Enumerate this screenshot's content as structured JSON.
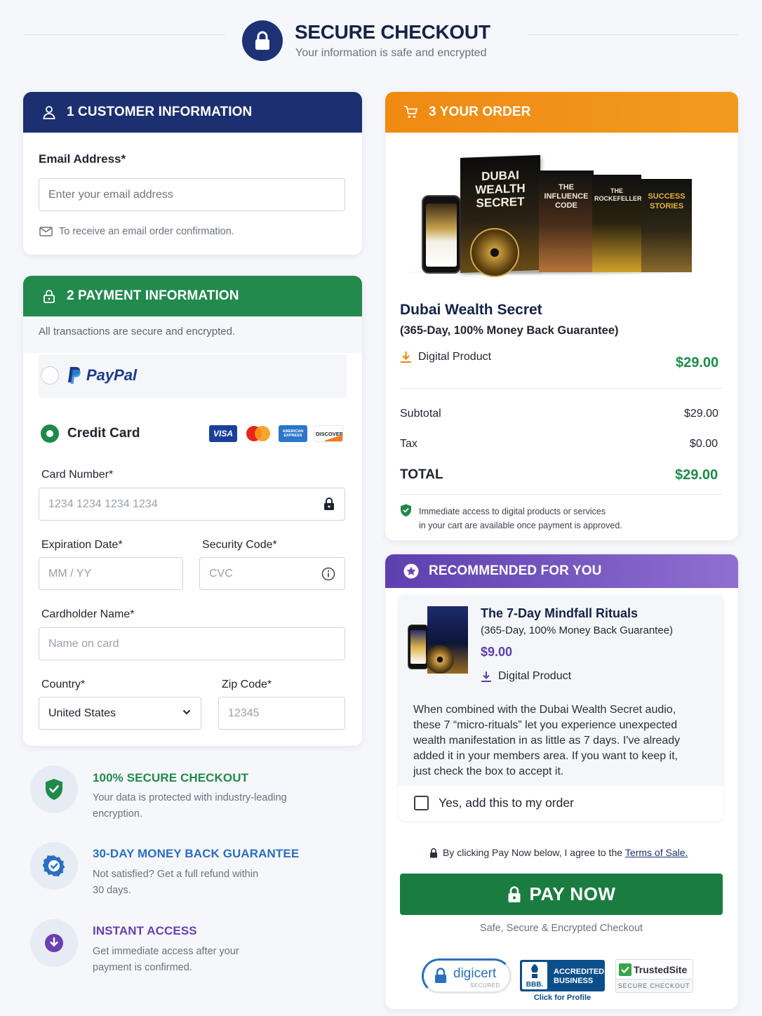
{
  "header": {
    "title": "SECURE CHECKOUT",
    "subtitle": "Your information is safe and encrypted"
  },
  "customer": {
    "heading": "1 CUSTOMER INFORMATION",
    "email_label": "Email Address*",
    "email_placeholder": "Enter your email address",
    "email_note": "To receive an email order confirmation."
  },
  "payment": {
    "heading": "2 PAYMENT INFORMATION",
    "secure_note": "All transactions are secure and encrypted.",
    "paypal_label": "PayPal",
    "credit_label": "Credit Card",
    "card_brands": [
      "VISA",
      "Mastercard",
      "AMERICAN EXPRESS",
      "DISCOVER"
    ],
    "card_number_label": "Card Number*",
    "card_number_placeholder": "1234 1234 1234 1234",
    "expiry_label": "Expiration Date*",
    "expiry_placeholder": "MM / YY",
    "cvc_label": "Security Code*",
    "cvc_placeholder": "CVC",
    "name_label": "Cardholder Name*",
    "name_placeholder": "Name on card",
    "country_label": "Country*",
    "country_value": "United States",
    "zip_label": "Zip Code*",
    "zip_placeholder": "12345"
  },
  "features": [
    {
      "title": "100% SECURE CHECKOUT",
      "text1": "Your data is protected with industry-leading",
      "text2": "encryption.",
      "color": "#1f8a4a"
    },
    {
      "title": "30-DAY MONEY BACK GUARANTEE",
      "text1": "Not satisfied? Get a full refund within",
      "text2": "30 days.",
      "color": "#2a6fc0"
    },
    {
      "title": "INSTANT ACCESS",
      "text1": "Get immediate access after your",
      "text2": "payment is confirmed.",
      "color": "#6a3fb0"
    }
  ],
  "order": {
    "heading": "3 YOUR ORDER",
    "box_titles": [
      "DUBAI WEALTH SECRET",
      "THE INFLUENCE CODE",
      "THE ROCKEFELLER",
      "SUCCESS STORIES"
    ],
    "product_name": "Dubai Wealth Secret",
    "product_guarantee": "(365-Day, 100% Money Back Guarantee)",
    "product_type": "Digital Product",
    "product_price": "$29.00",
    "subtotal_label": "Subtotal",
    "subtotal_value": "$29.00",
    "tax_label": "Tax",
    "tax_value": "$0.00",
    "total_label": "TOTAL",
    "total_value": "$29.00",
    "access_note1": "Immediate access to digital products or services",
    "access_note2": "in your cart are available once payment is approved."
  },
  "recommend": {
    "heading": "RECOMMENDED FOR YOU",
    "name": "The 7-Day Mindfall Rituals",
    "guarantee": "(365-Day, 100% Money Back Guarantee)",
    "price": "$9.00",
    "type": "Digital Product",
    "desc1": "When combined with the Dubai Wealth Secret audio,",
    "desc2": "these 7 “micro-rituals” let you experience unexpected",
    "desc3": "wealth manifestation in as little as 7 days. I've already",
    "desc4": "added it in your members area. If you want to keep it,",
    "desc5": "just check the box to accept it.",
    "checkbox_label": "Yes, add this to my order"
  },
  "checkout": {
    "terms_prefix": "By clicking Pay Now below, I agree to the",
    "terms_link": "Terms of Sale.",
    "pay_label": "PAY NOW",
    "safe_note": "Safe, Secure & Encrypted Checkout",
    "seal_digicert": "digicert",
    "seal_digicert_sub": "SECURED",
    "seal_bbb1": "ACCREDITED",
    "seal_bbb2": "BUSINESS",
    "seal_bbb_link": "Click for Profile",
    "seal_trusted": "TrustedSite",
    "seal_trusted_sub": "SECURE CHECKOUT"
  },
  "colors": {
    "navy": "#1c3274",
    "green": "#1f8a4a",
    "orange": "#f08a12",
    "purple": "#6a47b8"
  }
}
